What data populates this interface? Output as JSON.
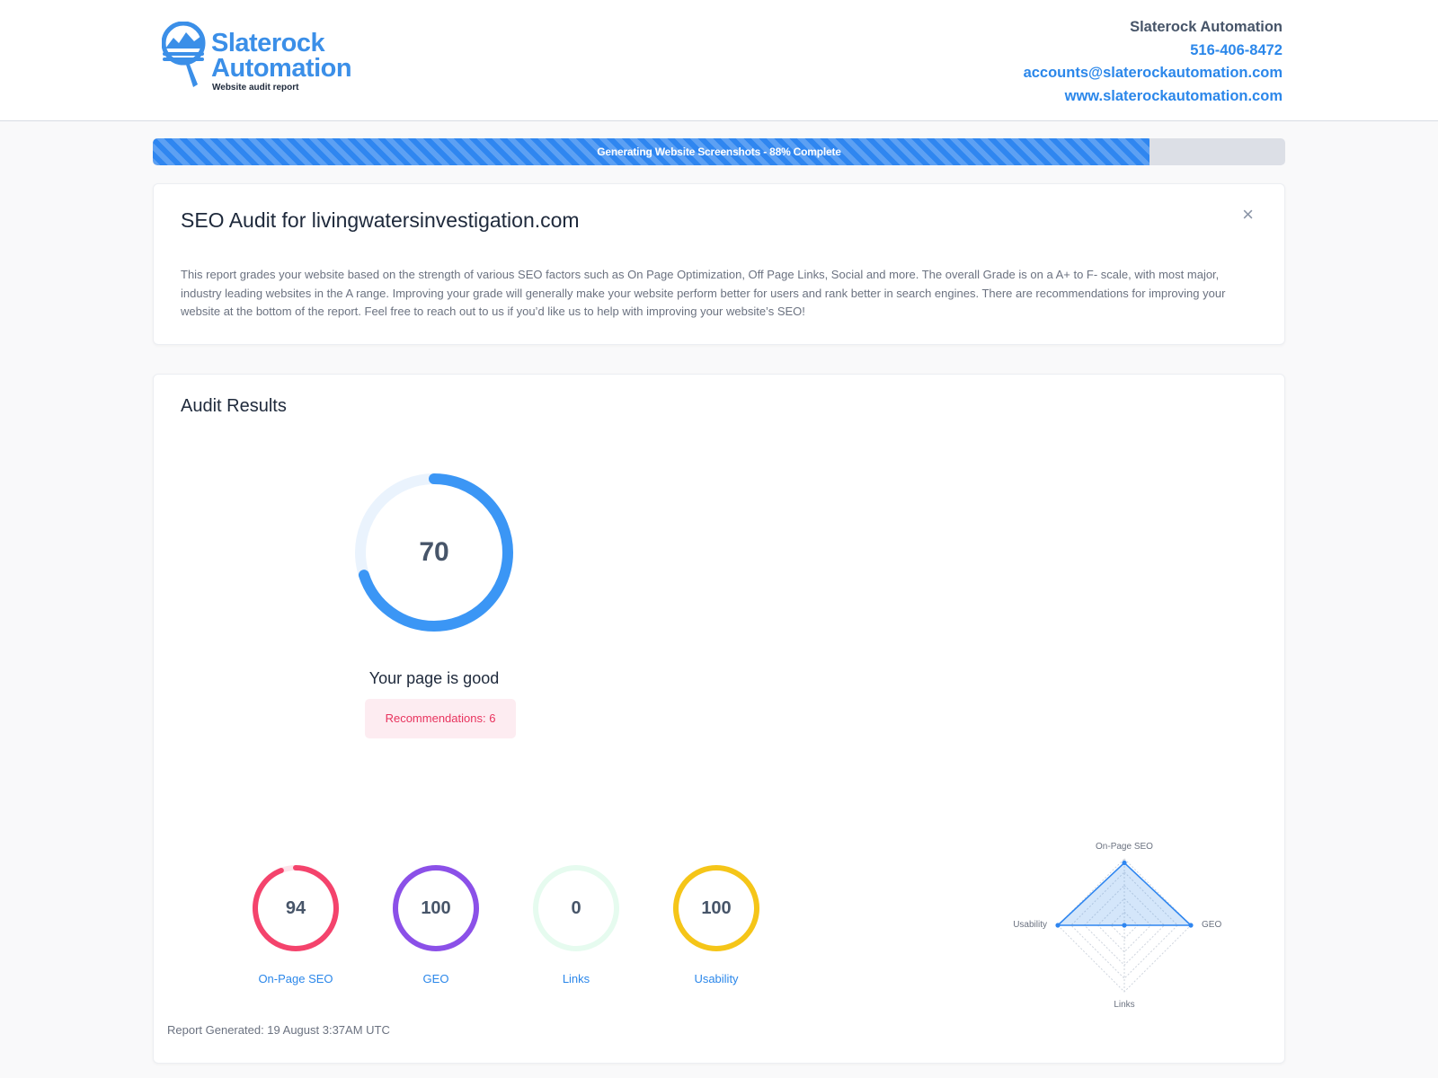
{
  "brand": {
    "name_line1": "Slaterock",
    "name_line2": "Automation",
    "tagline": "Website audit report",
    "accent": "#3b8fe8"
  },
  "contact": {
    "company": "Slaterock Automation",
    "phone": "516-406-8472",
    "email": "accounts@slaterockautomation.com",
    "website": "www.slaterockautomation.com"
  },
  "progress": {
    "text": "Generating Website Screenshots - 88% Complete",
    "fraction": 0.88
  },
  "intro": {
    "title": "SEO Audit for livingwatersinvestigation.com",
    "close_icon": "×",
    "body": "This report grades your website based on the strength of various SEO factors such as On Page Optimization, Off Page Links, Social and more. The overall Grade is on a A+ to F- scale, with most major, industry leading websites in the A range. Improving your grade will generally make your website perform better for users and rank better in search engines. There are recommendations for improving your website at the bottom of the report. Feel free to reach out to us if you’d like us to help with improving your website’s SEO!"
  },
  "results": {
    "title": "Audit Results",
    "overall_score": "70",
    "overall_fraction": 0.7,
    "overall_color": "#3b96f5",
    "overall_track": "#eaf3fd",
    "status": "Your page is good",
    "recommendations": "Recommendations: 6",
    "categories": [
      {
        "label": "On-Page SEO",
        "score": "94",
        "fraction": 0.94,
        "color": "#f4436c",
        "track": "#fde3ea"
      },
      {
        "label": "GEO",
        "score": "100",
        "fraction": 1.0,
        "color": "#8b50e8",
        "track": "#efe6fc"
      },
      {
        "label": "Links",
        "score": "0",
        "fraction": 0.0,
        "color": "#34d399",
        "track": "#e6fbef"
      },
      {
        "label": "Usability",
        "score": "100",
        "fraction": 1.0,
        "color": "#f5c518",
        "track": "#fdf5d3"
      }
    ],
    "radar_labels": [
      "On-Page SEO",
      "GEO",
      "Links",
      "Usability"
    ],
    "generated": "Report Generated: 19 August 3:37AM UTC"
  }
}
